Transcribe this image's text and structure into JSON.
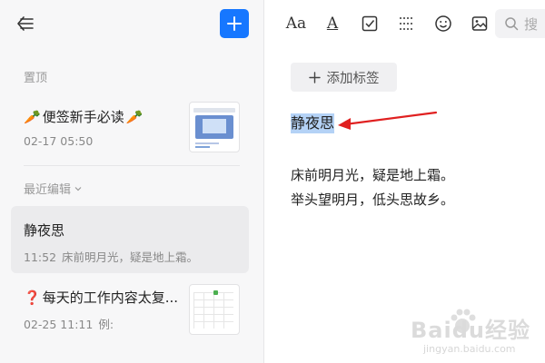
{
  "sidebar": {
    "pinned_label": "置顶",
    "recent_label": "最近编辑",
    "notes": [
      {
        "emoji_left": "🥕",
        "title": "便签新手必读",
        "emoji_right": "🥕",
        "time": "02-17 05:50",
        "preview": ""
      },
      {
        "title": "静夜思",
        "time": "11:52",
        "preview": "床前明月光，疑是地上霜。",
        "selected": true
      },
      {
        "emoji_left": "❓",
        "title": "每天的工作内容太复...",
        "time": "02-25 11:11",
        "preview": "例:"
      }
    ]
  },
  "toolbar": {
    "font_icon_text": "Aa",
    "color_icon_text": "A",
    "search_placeholder": "搜"
  },
  "editor": {
    "add_tag_label": "添加标签",
    "title": "静夜思",
    "lines": [
      "床前明月光，疑是地上霜。",
      "举头望明月，低头思故乡。"
    ]
  },
  "watermark": {
    "text": "Baidu经验",
    "subtext": "jingyan.baidu.com"
  },
  "colors": {
    "accent": "#1677ff",
    "selection": "#b4d2f6",
    "annotation_arrow": "#e02020"
  }
}
